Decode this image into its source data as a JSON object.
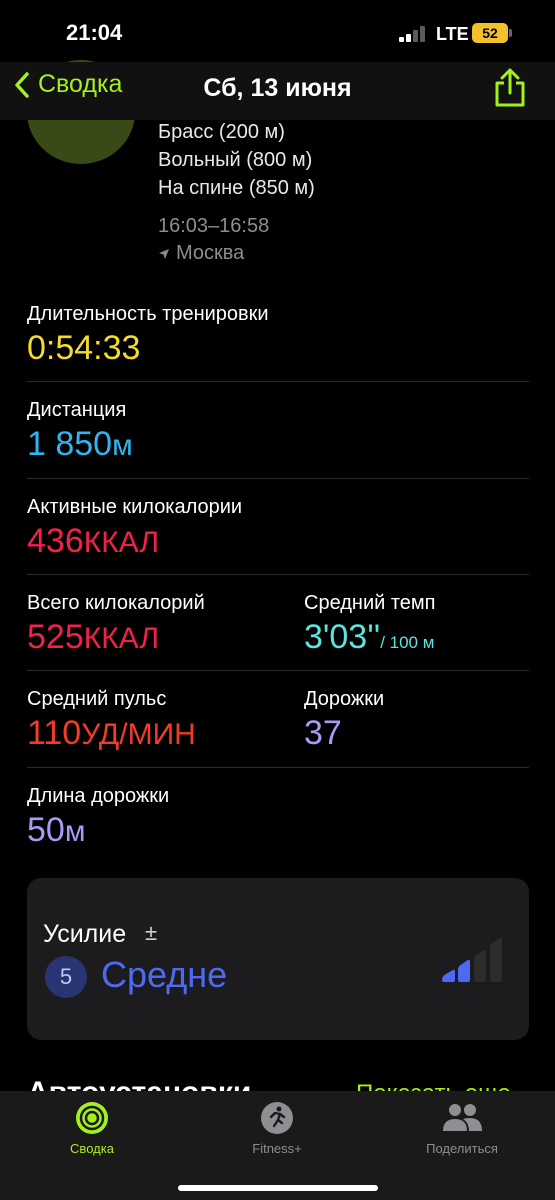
{
  "status_bar": {
    "time": "21:04",
    "network": "LTE",
    "battery": "52"
  },
  "nav": {
    "back_label": "Сводка",
    "title": "Сб, 13 июня"
  },
  "summary": {
    "strokes": [
      "Брасс (200 м)",
      "Вольный (800 м)",
      "На спине (850 м)"
    ],
    "time_range": "16:03–16:58",
    "location": "Москва"
  },
  "metrics": {
    "duration": {
      "label": "Длительность тренировки",
      "value": "0:54:33"
    },
    "distance": {
      "label": "Дистанция",
      "value": "1 850",
      "unit": "м"
    },
    "active_kcal": {
      "label": "Активные килокалории",
      "value": "436",
      "unit": "ККАЛ"
    },
    "total_kcal": {
      "label": "Всего килокалорий",
      "value": "525",
      "unit": "ККАЛ"
    },
    "avg_pace": {
      "label": "Средний темп",
      "value": "3'03''",
      "unit": "/ 100 м"
    },
    "avg_hr": {
      "label": "Средний пульс",
      "value": "110",
      "unit": "УД/МИН"
    },
    "laps": {
      "label": "Дорожки",
      "value": "37"
    },
    "pool_length": {
      "label": "Длина дорожки",
      "value": "50",
      "unit": "м"
    }
  },
  "effort": {
    "label": "Усилие",
    "pm": "±",
    "number": "5",
    "level": "Средне",
    "bars_filled": 2,
    "bars_total": 4
  },
  "next_section": {
    "title": "Автоустановки",
    "link": "Показать еще"
  },
  "tabs": [
    {
      "label": "Сводка",
      "icon": "activity-rings-icon",
      "color": "#a4f01d"
    },
    {
      "label": "Fitness+",
      "icon": "runner-icon",
      "color": "#8e8e93"
    },
    {
      "label": "Поделиться",
      "icon": "people-icon",
      "color": "#8e8e93"
    }
  ]
}
